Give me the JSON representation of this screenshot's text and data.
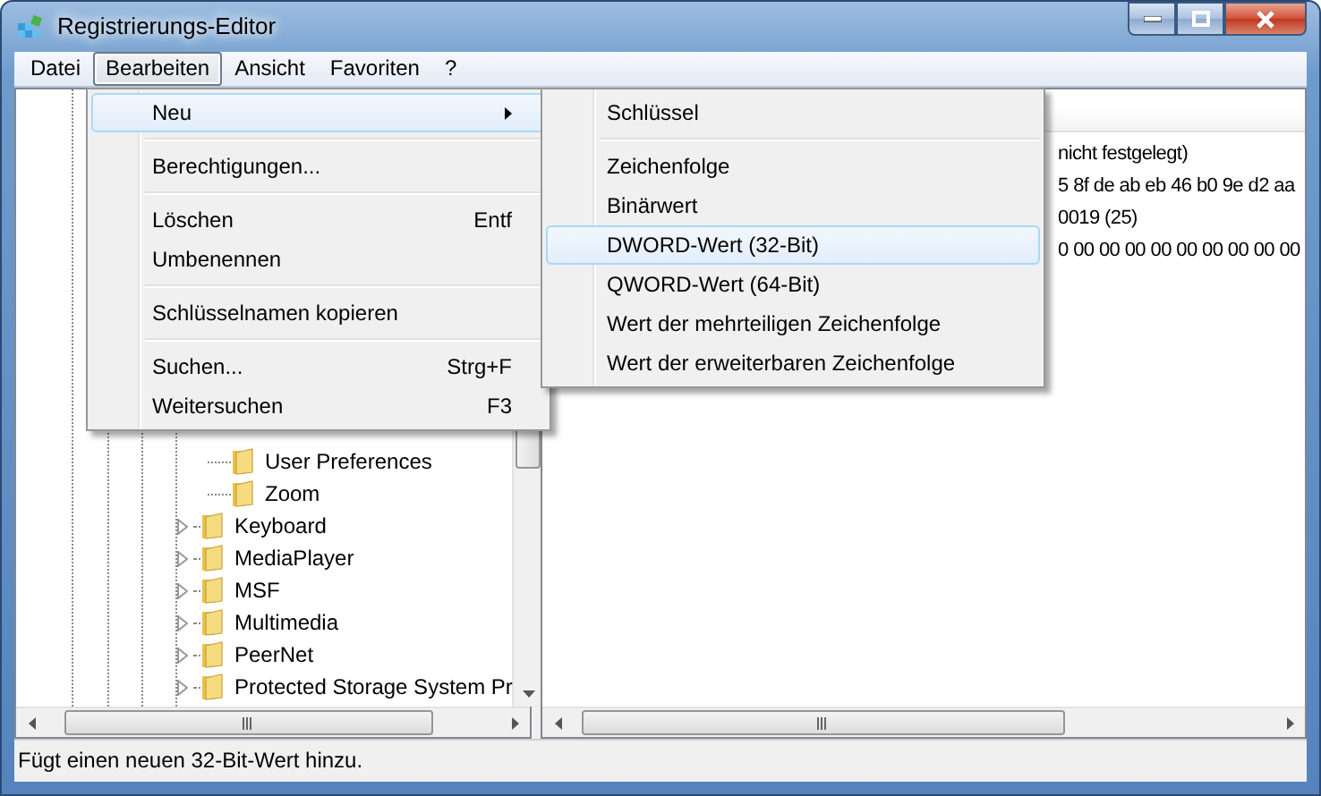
{
  "window": {
    "title": "Registrierungs-Editor"
  },
  "menu_bar": [
    {
      "label": "Datei",
      "selected": false
    },
    {
      "label": "Bearbeiten",
      "selected": true
    },
    {
      "label": "Ansicht",
      "selected": false
    },
    {
      "label": "Favoriten",
      "selected": false
    },
    {
      "label": "?",
      "selected": false
    }
  ],
  "edit_menu": [
    {
      "kind": "item",
      "label": "Neu",
      "submenu": true,
      "selected": true
    },
    {
      "kind": "separator"
    },
    {
      "kind": "item",
      "label": "Berechtigungen...",
      "selected": false
    },
    {
      "kind": "separator"
    },
    {
      "kind": "item",
      "label": "Löschen",
      "shortcut": "Entf",
      "selected": false
    },
    {
      "kind": "item",
      "label": "Umbenennen",
      "selected": false
    },
    {
      "kind": "separator"
    },
    {
      "kind": "item",
      "label": "Schlüsselnamen kopieren",
      "selected": false
    },
    {
      "kind": "separator"
    },
    {
      "kind": "item",
      "label": "Suchen...",
      "shortcut": "Strg+F",
      "selected": false
    },
    {
      "kind": "item",
      "label": "Weitersuchen",
      "shortcut": "F3",
      "selected": false
    }
  ],
  "new_submenu": [
    {
      "kind": "item",
      "label": "Schlüssel",
      "selected": false
    },
    {
      "kind": "separator"
    },
    {
      "kind": "item",
      "label": "Zeichenfolge",
      "selected": false
    },
    {
      "kind": "item",
      "label": "Binärwert",
      "selected": false
    },
    {
      "kind": "item",
      "label": "DWORD-Wert (32-Bit)",
      "selected": true
    },
    {
      "kind": "item",
      "label": "QWORD-Wert (64-Bit)",
      "selected": false
    },
    {
      "kind": "item",
      "label": "Wert der mehrteiligen Zeichenfolge",
      "selected": false
    },
    {
      "kind": "item",
      "label": "Wert der erweiterbaren Zeichenfolge",
      "selected": false
    }
  ],
  "tree": [
    {
      "children": [
        {
          "label": "User Preferences"
        },
        {
          "label": "Zoom"
        }
      ]
    },
    {
      "label": "Keyboard",
      "expanded": false
    },
    {
      "label": "MediaPlayer",
      "expanded": false
    },
    {
      "label": "MSF",
      "expanded": false
    },
    {
      "label": "Multimedia",
      "expanded": false
    },
    {
      "label": "PeerNet",
      "expanded": false
    },
    {
      "label": "Protected Storage System Pr",
      "expanded": false
    }
  ],
  "values": [
    {
      "data": "nicht festgelegt)"
    },
    {
      "data": "5 8f de ab eb 46 b0 9e d2 aa"
    },
    {
      "data": "0019 (25)"
    },
    {
      "data": "0 00 00 00 00 00 00 00 00 00"
    }
  ],
  "status_bar": "Fügt einen neuen 32-Bit-Wert hinzu."
}
